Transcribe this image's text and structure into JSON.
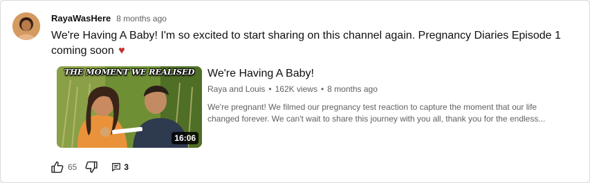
{
  "comment": {
    "author": "RayaWasHere",
    "timestamp": "8 months ago",
    "text": "We're Having A Baby! I'm so excited to start sharing on this channel again. Pregnancy Diaries Episode 1 coming soon",
    "emoji": "♥",
    "avatar_icon": "user-avatar"
  },
  "video": {
    "thumbnail_caption": "THE MOMENT WE REALISED",
    "duration": "16:06",
    "title": "We're Having A Baby!",
    "channel": "Raya and Louis",
    "views": "162K views",
    "age": "8 months ago",
    "separator": "•",
    "description_line1": "We're pregnant! We filmed our pregnancy test reaction to capture the moment that our life",
    "description_line2": "changed forever. We can't wait to share this journey with you all, thank you for the endless..."
  },
  "actions": {
    "like_icon": "thumbs-up-icon",
    "like_count": "65",
    "dislike_icon": "thumbs-down-icon",
    "reply_icon": "comment-icon",
    "reply_count": "3"
  },
  "colors": {
    "text_primary": "#0f0f0f",
    "text_secondary": "#606060",
    "heart": "#c4302b",
    "card_background": "#ffffff"
  }
}
